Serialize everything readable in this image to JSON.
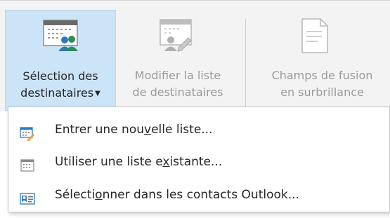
{
  "ribbon": {
    "buttons": [
      {
        "line1": "Sélection des",
        "line2": "destinataires",
        "icon": "mail-recipients-icon",
        "has_dropdown": true,
        "state": "pressed"
      },
      {
        "line1": "Modifier la liste",
        "line2": "de destinataires",
        "icon": "edit-recipient-list-icon",
        "state": "disabled"
      },
      {
        "line1": "Champs de fusion",
        "line2": "en surbrillance",
        "icon": "highlight-merge-fields-icon",
        "state": "disabled"
      }
    ]
  },
  "menu": {
    "items": [
      {
        "pre": "Entrer une nou",
        "access_key": "v",
        "post": "elle liste...",
        "icon": "new-list-icon"
      },
      {
        "pre": "Utiliser une liste e",
        "access_key": "x",
        "post": "istante...",
        "icon": "existing-list-icon"
      },
      {
        "pre": "Sélecti",
        "access_key": "o",
        "post": "nner dans les contacts Outlook...",
        "icon": "outlook-contacts-icon"
      }
    ]
  },
  "colors": {
    "ribbon_bg": "#f3f3f3",
    "pressed_bg": "#cce4f7",
    "disabled_text": "#9a9a9a",
    "accent_blue": "#2b79c2"
  }
}
